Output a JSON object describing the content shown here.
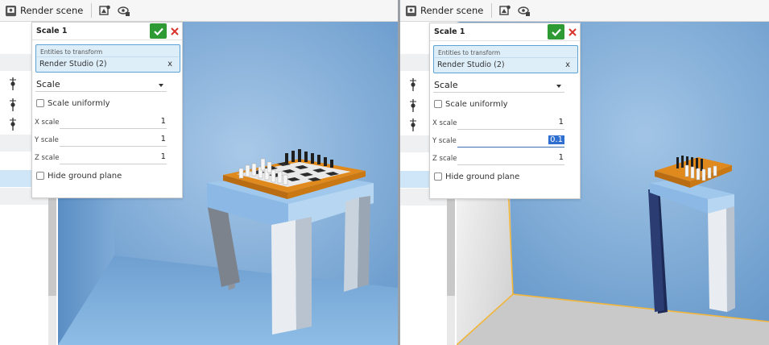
{
  "toolbar": {
    "render_scene_label": "Render scene",
    "icons": [
      "render-scene-icon",
      "render-settings-icon",
      "render-view-icon"
    ]
  },
  "dialog": {
    "title": "Scale 1",
    "entities_label": "Entities to transform",
    "entity_value": "Render Studio (2)",
    "remove_glyph": "x",
    "scale_type": "Scale",
    "scale_uniformly_label": "Scale uniformly",
    "hide_ground_label": "Hide ground plane",
    "x_label": "X scale",
    "y_label": "Y scale",
    "z_label": "Z scale"
  },
  "left_panel": {
    "x_value": "1",
    "y_value": "1",
    "z_value": "1"
  },
  "right_panel": {
    "x_value": "1",
    "y_value": "0.1",
    "z_value": "1"
  },
  "colors": {
    "viewport_blue": "#7aaad6",
    "accept_green": "#2e9a33",
    "cancel_red": "#d9342b",
    "entity_bg": "#ddeef9",
    "board_orange": "#e08a1e",
    "ground_edge": "#f2b63a"
  }
}
